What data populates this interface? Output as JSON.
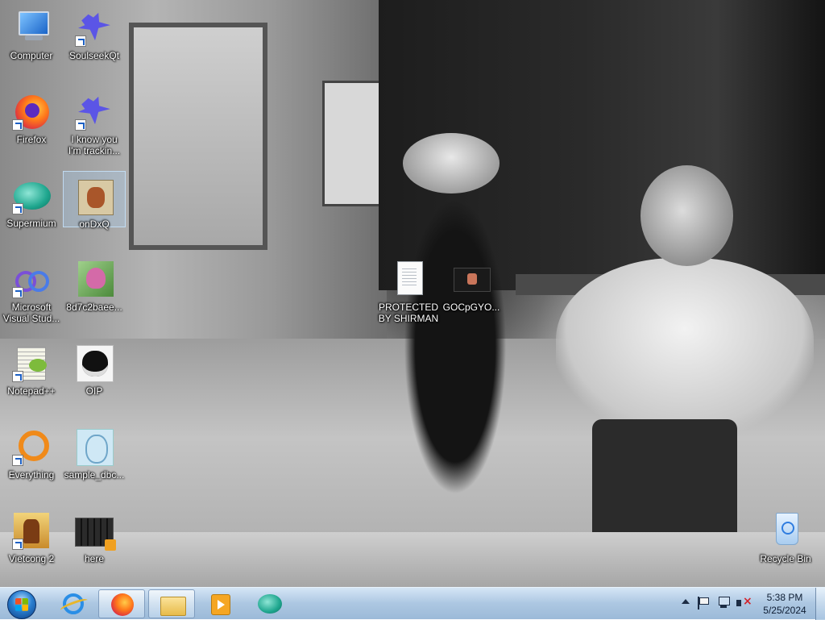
{
  "desktop": {
    "icons": [
      {
        "label": "Computer",
        "icon": "computer-icon",
        "shortcut": false
      },
      {
        "label": "SoulseekQt",
        "icon": "soulseek-bird-icon",
        "shortcut": true
      },
      {
        "label": "Firefox",
        "icon": "firefox-icon",
        "shortcut": true
      },
      {
        "label": "I know you I'm trackin...",
        "icon": "soulseek-bird-icon",
        "shortcut": true
      },
      {
        "label": "Supermium",
        "icon": "supermium-icon",
        "shortcut": true
      },
      {
        "label": "onDxQ",
        "icon": "ondxq-image-icon",
        "shortcut": false,
        "selected": true
      },
      {
        "label": "Microsoft Visual Stud...",
        "icon": "visual-studio-icon",
        "shortcut": true
      },
      {
        "label": "8d7c2baee...",
        "icon": "image-thumbnail-icon",
        "shortcut": false
      },
      {
        "label": "PROTECTED BY SHIRMAN",
        "icon": "text-document-icon",
        "shortcut": false
      },
      {
        "label": "GOCpGYO...",
        "icon": "video-thumbnail-icon",
        "shortcut": false
      },
      {
        "label": "Notepad++",
        "icon": "notepadpp-icon",
        "shortcut": true
      },
      {
        "label": "OIP",
        "icon": "image-thumbnail-icon",
        "shortcut": false
      },
      {
        "label": "Everything",
        "icon": "everything-search-icon",
        "shortcut": true
      },
      {
        "label": "sample_dbc...",
        "icon": "image-thumbnail-icon",
        "shortcut": false
      },
      {
        "label": "Vietcong 2",
        "icon": "vietcong-game-icon",
        "shortcut": true
      },
      {
        "label": "here",
        "icon": "video-file-icon",
        "shortcut": false
      },
      {
        "label": "Recycle Bin",
        "icon": "recycle-bin-icon",
        "shortcut": false
      }
    ]
  },
  "taskbar": {
    "start_icon": "windows-start-orb-icon",
    "pinned": [
      {
        "name": "internet-explorer",
        "icon": "internet-explorer-icon",
        "active": false
      },
      {
        "name": "firefox",
        "icon": "firefox-icon",
        "active": true
      },
      {
        "name": "file-explorer",
        "icon": "folder-icon",
        "active": false
      },
      {
        "name": "media-player",
        "icon": "media-player-icon",
        "active": false
      },
      {
        "name": "supermium",
        "icon": "supermium-icon",
        "active": false
      }
    ],
    "tray": {
      "icons": [
        "show-hidden-icons-chevron-icon",
        "action-center-flag-icon",
        "network-icon",
        "volume-muted-icon"
      ],
      "time": "5:38 PM",
      "date": "5/25/2024"
    }
  }
}
